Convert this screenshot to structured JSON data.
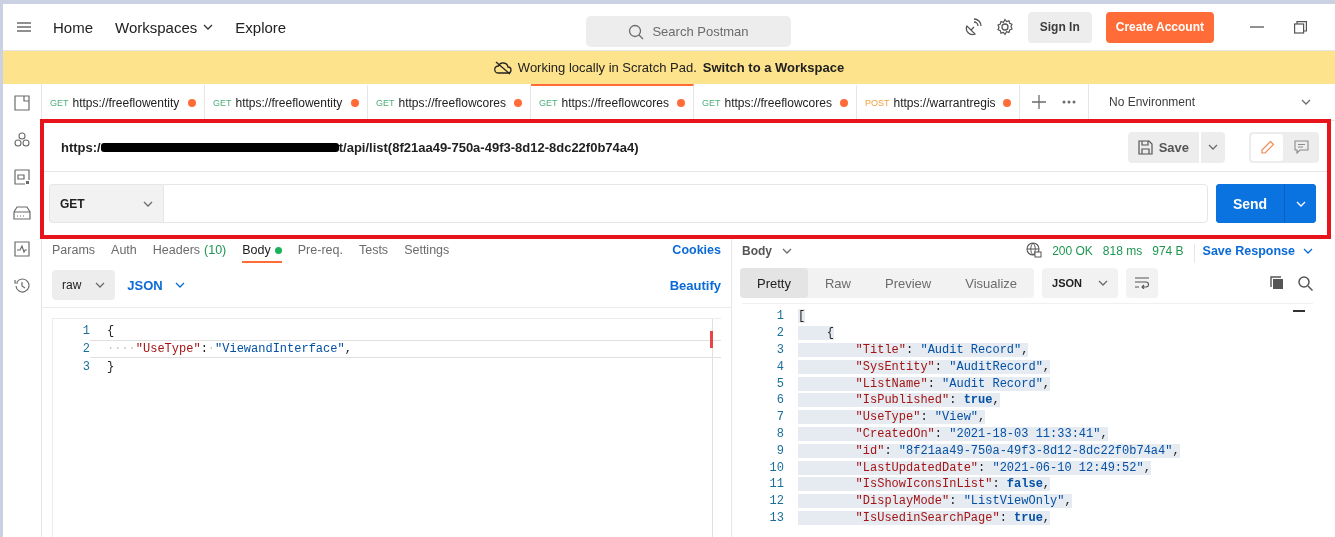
{
  "nav": {
    "links": [
      {
        "label": "Home",
        "dropdown": false
      },
      {
        "label": "Workspaces",
        "dropdown": true
      },
      {
        "label": "Explore",
        "dropdown": false
      }
    ],
    "search": {
      "placeholder": "Search Postman"
    },
    "sign_in": "Sign In",
    "create_account": "Create Account"
  },
  "banner": {
    "text": "Working locally in Scratch Pad.",
    "link": "Switch to a Workspace"
  },
  "tabs": [
    {
      "method": "GET",
      "kind": "get",
      "url": "https://freeflowentity",
      "unsaved": true,
      "selected": false
    },
    {
      "method": "GET",
      "kind": "get",
      "url": "https://freeflowentity",
      "unsaved": true,
      "selected": false
    },
    {
      "method": "GET",
      "kind": "get",
      "url": "https://freeflowcores",
      "unsaved": true,
      "selected": false
    },
    {
      "method": "GET",
      "kind": "get",
      "url": "https://freeflowcores",
      "unsaved": true,
      "selected": true
    },
    {
      "method": "GET",
      "kind": "get",
      "url": "https://freeflowcores",
      "unsaved": true,
      "selected": false
    },
    {
      "method": "POST",
      "kind": "post",
      "url": "https://warrantregis",
      "unsaved": true,
      "selected": false
    }
  ],
  "environment": "No Environment",
  "request": {
    "url_start": "https:/",
    "url_end": "t/api/list(8f21aa49-750a-49f3-8d12-8dc22f0b74a4)",
    "save": "Save",
    "method": "GET",
    "send": "Send",
    "tabs": [
      {
        "label": "Params",
        "dot": false,
        "selected": false
      },
      {
        "label": "Auth",
        "dot": false,
        "selected": false
      },
      {
        "label": "Headers",
        "count": "(10)",
        "dot": false,
        "selected": false
      },
      {
        "label": "Body",
        "dot": true,
        "selected": true
      },
      {
        "label": "Pre-req.",
        "dot": false,
        "selected": false
      },
      {
        "label": "Tests",
        "dot": false,
        "selected": false
      },
      {
        "label": "Settings",
        "dot": false,
        "selected": false
      }
    ],
    "cookies": "Cookies",
    "body_mode": "raw",
    "body_format": "JSON",
    "beautify": "Beautify",
    "lines": [
      {
        "number": "1",
        "text": "{",
        "current": false
      },
      {
        "number": "2",
        "text": "····\"UseType\":·\"ViewandInterface\",",
        "current": true
      },
      {
        "number": "3",
        "text": "}",
        "current": false
      }
    ]
  },
  "response": {
    "label": "Body",
    "status": "200 OK",
    "time": "818 ms",
    "size": "974 B",
    "save": "Save Response",
    "views": [
      {
        "label": "Pretty",
        "selected": true
      },
      {
        "label": "Raw",
        "selected": false
      },
      {
        "label": "Preview",
        "selected": false
      },
      {
        "label": "Visualize",
        "selected": false
      }
    ],
    "format": "JSON",
    "lines": [
      {
        "number": "1",
        "text": "["
      },
      {
        "number": "2",
        "text": "    {"
      },
      {
        "number": "3",
        "text": "        \"Title\": \"Audit Record\","
      },
      {
        "number": "4",
        "text": "        \"SysEntity\": \"AuditRecord\","
      },
      {
        "number": "5",
        "text": "        \"ListName\": \"Audit Record\","
      },
      {
        "number": "6",
        "text": "        \"IsPublished\": true,"
      },
      {
        "number": "7",
        "text": "        \"UseType\": \"View\","
      },
      {
        "number": "8",
        "text": "        \"CreatedOn\": \"2021-18-03 11:33:41\","
      },
      {
        "number": "9",
        "text": "        \"id\": \"8f21aa49-750a-49f3-8d12-8dc22f0b74a4\","
      },
      {
        "number": "10",
        "text": "        \"LastUpdatedDate\": \"2021-06-10 12:49:52\","
      },
      {
        "number": "11",
        "text": "        \"IsShowIconsInList\": false,"
      },
      {
        "number": "12",
        "text": "        \"DisplayMode\": \"ListViewOnly\","
      },
      {
        "number": "13",
        "text": "        \"IsUsedinSearchPage\": true,"
      }
    ]
  }
}
